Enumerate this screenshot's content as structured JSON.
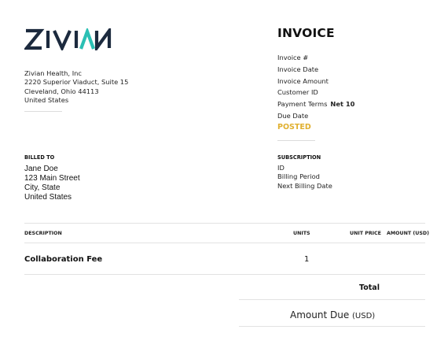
{
  "brand": {
    "logo_text": "ZIVIAN",
    "color": "#1c2a3e",
    "accent": "#2bc0b4"
  },
  "sender": {
    "lines": [
      "Zivian Health, Inc",
      "2220 Superior Viaduct, Suite 15",
      "Cleveland, Ohio 44113",
      "United States"
    ]
  },
  "invoice": {
    "title": "INVOICE",
    "fields": [
      {
        "label": "Invoice #",
        "value": ""
      },
      {
        "label": "Invoice Date",
        "value": ""
      },
      {
        "label": "Invoice Amount",
        "value": ""
      },
      {
        "label": "Customer ID",
        "value": ""
      },
      {
        "label": "Payment Terms",
        "value": "Net 10"
      },
      {
        "label": "Due Date",
        "value": ""
      }
    ],
    "status": "POSTED",
    "status_color": "#e0b030"
  },
  "billed_to": {
    "heading": "BILLED TO",
    "lines": [
      "Jane Doe",
      "123 Main Street",
      "City, State",
      "United States"
    ]
  },
  "subscription": {
    "heading": "SUBSCRIPTION",
    "lines": [
      "ID",
      "Billing Period",
      "Next Billing Date"
    ]
  },
  "table": {
    "headers": {
      "description": "DESCRIPTION",
      "units": "UNITS",
      "unit_price": "UNIT PRICE",
      "amount": "AMOUNT (USD)"
    },
    "rows": [
      {
        "description": "Collaboration Fee",
        "units": "1",
        "unit_price": "",
        "amount": ""
      }
    ]
  },
  "totals": {
    "total_label": "Total",
    "amount_due_label": "Amount Due",
    "currency": "(USD)"
  }
}
